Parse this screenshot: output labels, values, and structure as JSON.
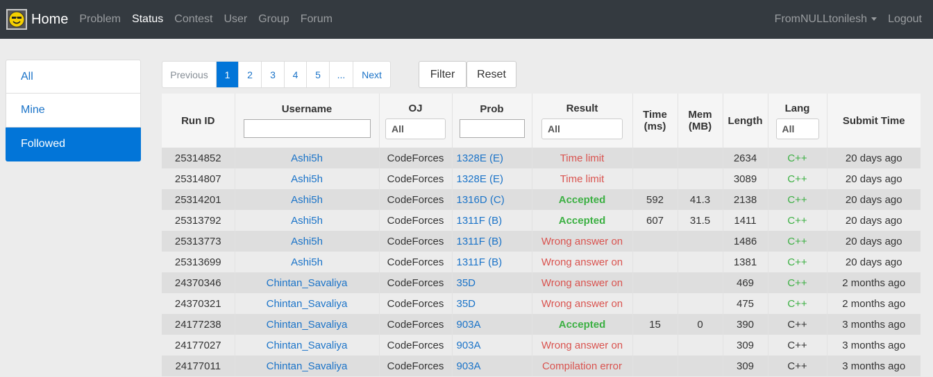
{
  "nav": {
    "brand": "Home",
    "links": [
      "Problem",
      "Status",
      "Contest",
      "User",
      "Group",
      "Forum"
    ],
    "user": "FromNULLtonilesh",
    "logout": "Logout"
  },
  "sidebar": {
    "items": [
      {
        "label": "All"
      },
      {
        "label": "Mine"
      },
      {
        "label": "Followed"
      }
    ]
  },
  "pagination": {
    "previous": "Previous",
    "pages": [
      "1",
      "2",
      "3",
      "4",
      "5",
      "..."
    ],
    "next": "Next"
  },
  "buttons": {
    "filter": "Filter",
    "reset": "Reset"
  },
  "table": {
    "headers": {
      "run_id": "Run ID",
      "username": "Username",
      "oj": "OJ",
      "oj_value": "All",
      "prob": "Prob",
      "result": "Result",
      "result_value": "All",
      "time": "Time (ms)",
      "mem": "Mem (MB)",
      "length": "Length",
      "lang": "Lang",
      "lang_value": "All",
      "submit": "Submit Time"
    },
    "rows": [
      {
        "run_id": "25314852",
        "user": "Ashi5h",
        "oj": "CodeForces",
        "prob": "1328E",
        "prob_sub": "(E)",
        "result": "Time limit",
        "result_kind": "tl",
        "time": "",
        "mem": "",
        "length": "2634",
        "lang": "C++",
        "lang_green": true,
        "submit": "20 days ago"
      },
      {
        "run_id": "25314807",
        "user": "Ashi5h",
        "oj": "CodeForces",
        "prob": "1328E",
        "prob_sub": "(E)",
        "result": "Time limit",
        "result_kind": "tl",
        "time": "",
        "mem": "",
        "length": "3089",
        "lang": "C++",
        "lang_green": true,
        "submit": "20 days ago"
      },
      {
        "run_id": "25314201",
        "user": "Ashi5h",
        "oj": "CodeForces",
        "prob": "1316D",
        "prob_sub": "(C)",
        "result": "Accepted",
        "result_kind": "ac",
        "time": "592",
        "mem": "41.3",
        "length": "2138",
        "lang": "C++",
        "lang_green": true,
        "submit": "20 days ago"
      },
      {
        "run_id": "25313792",
        "user": "Ashi5h",
        "oj": "CodeForces",
        "prob": "1311F",
        "prob_sub": "(B)",
        "result": "Accepted",
        "result_kind": "ac",
        "time": "607",
        "mem": "31.5",
        "length": "1411",
        "lang": "C++",
        "lang_green": true,
        "submit": "20 days ago"
      },
      {
        "run_id": "25313773",
        "user": "Ashi5h",
        "oj": "CodeForces",
        "prob": "1311F",
        "prob_sub": "(B)",
        "result": "Wrong answer on",
        "result_kind": "wa",
        "time": "",
        "mem": "",
        "length": "1486",
        "lang": "C++",
        "lang_green": true,
        "submit": "20 days ago"
      },
      {
        "run_id": "25313699",
        "user": "Ashi5h",
        "oj": "CodeForces",
        "prob": "1311F",
        "prob_sub": "(B)",
        "result": "Wrong answer on",
        "result_kind": "wa",
        "time": "",
        "mem": "",
        "length": "1381",
        "lang": "C++",
        "lang_green": true,
        "submit": "20 days ago"
      },
      {
        "run_id": "24370346",
        "user": "Chintan_Savaliya",
        "oj": "CodeForces",
        "prob": "35D",
        "prob_sub": "",
        "result": "Wrong answer on",
        "result_kind": "wa",
        "time": "",
        "mem": "",
        "length": "469",
        "lang": "C++",
        "lang_green": true,
        "submit": "2 months ago"
      },
      {
        "run_id": "24370321",
        "user": "Chintan_Savaliya",
        "oj": "CodeForces",
        "prob": "35D",
        "prob_sub": "",
        "result": "Wrong answer on",
        "result_kind": "wa",
        "time": "",
        "mem": "",
        "length": "475",
        "lang": "C++",
        "lang_green": true,
        "submit": "2 months ago"
      },
      {
        "run_id": "24177238",
        "user": "Chintan_Savaliya",
        "oj": "CodeForces",
        "prob": "903A",
        "prob_sub": "",
        "result": "Accepted",
        "result_kind": "ac",
        "time": "15",
        "mem": "0",
        "length": "390",
        "lang": "C++",
        "lang_green": false,
        "submit": "3 months ago"
      },
      {
        "run_id": "24177027",
        "user": "Chintan_Savaliya",
        "oj": "CodeForces",
        "prob": "903A",
        "prob_sub": "",
        "result": "Wrong answer on",
        "result_kind": "wa",
        "time": "",
        "mem": "",
        "length": "309",
        "lang": "C++",
        "lang_green": false,
        "submit": "3 months ago"
      },
      {
        "run_id": "24177011",
        "user": "Chintan_Savaliya",
        "oj": "CodeForces",
        "prob": "903A",
        "prob_sub": "",
        "result": "Compilation error",
        "result_kind": "ce",
        "time": "",
        "mem": "",
        "length": "309",
        "lang": "C++",
        "lang_green": false,
        "submit": "3 months ago"
      }
    ]
  }
}
